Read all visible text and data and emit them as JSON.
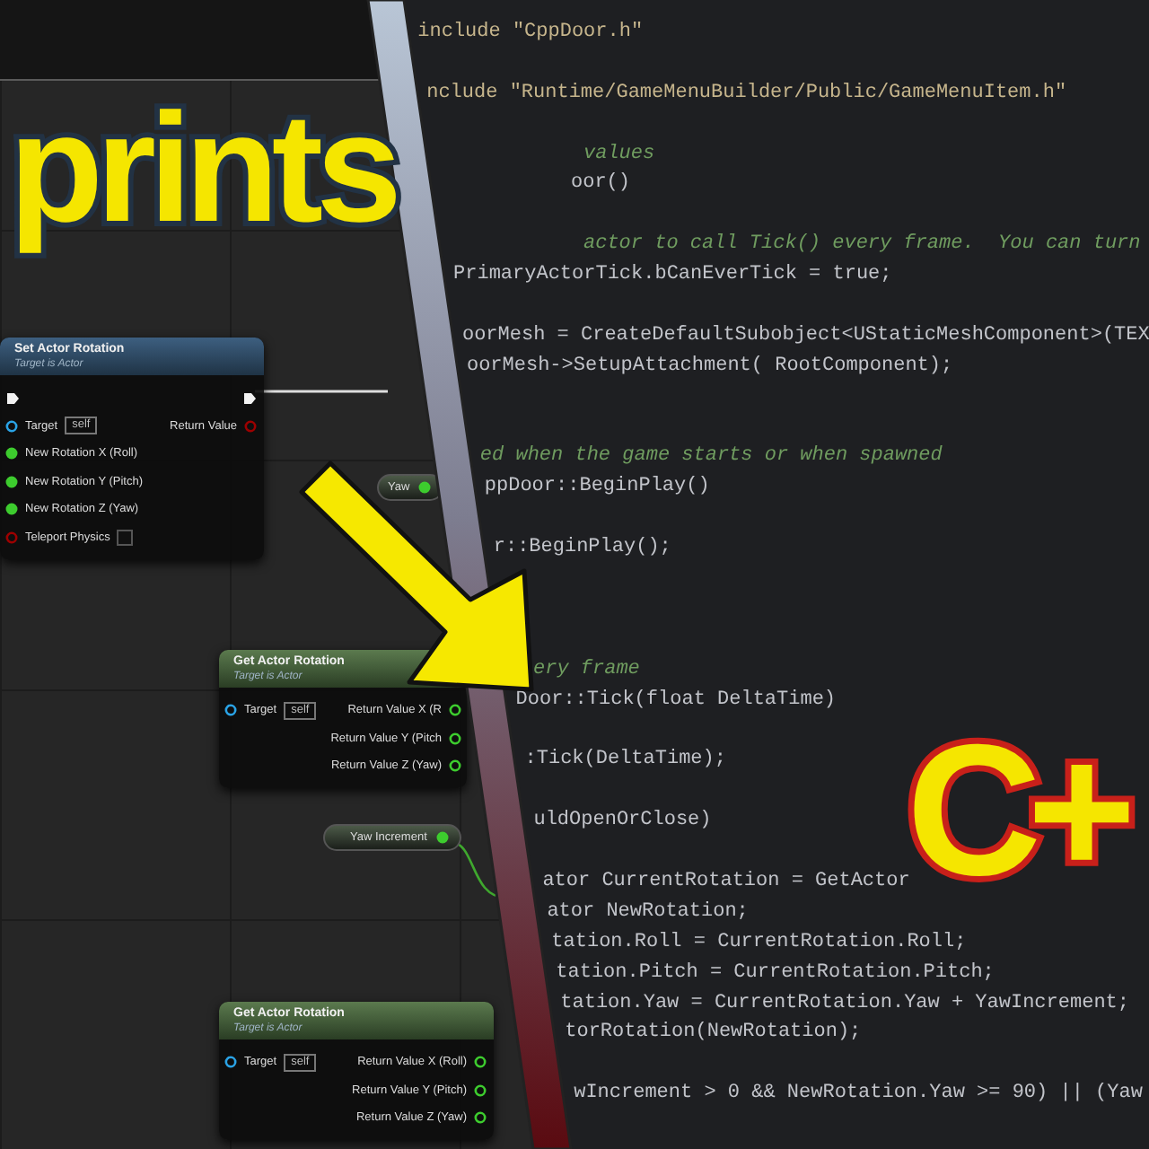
{
  "blueprint": {
    "nodes": [
      {
        "kind": "impure",
        "title": "Set Actor Rotation",
        "subtitle": "Target is Actor",
        "inputs": [
          {
            "kind": "object",
            "label": "Target",
            "value": "self"
          },
          {
            "kind": "float",
            "label": "New Rotation X (Roll)"
          },
          {
            "kind": "float",
            "label": "New Rotation Y (Pitch)"
          },
          {
            "kind": "float",
            "label": "New Rotation Z (Yaw)"
          },
          {
            "kind": "bool",
            "label": "Teleport Physics",
            "checked": false
          }
        ],
        "outputs": [
          {
            "kind": "bool",
            "label": "Return Value"
          }
        ]
      },
      {
        "kind": "variable",
        "title": "Yaw"
      },
      {
        "kind": "pure",
        "title": "Get Actor Rotation",
        "subtitle": "Target is Actor",
        "inputs": [
          {
            "kind": "object",
            "label": "Target",
            "value": "self"
          }
        ],
        "outputs": [
          {
            "kind": "float",
            "label": "Return Value X (R"
          },
          {
            "kind": "float",
            "label": "Return Value Y (Pitch"
          },
          {
            "kind": "float",
            "label": "Return Value Z (Yaw)"
          }
        ]
      },
      {
        "kind": "variable",
        "title": "Yaw Increment"
      },
      {
        "kind": "pure",
        "title": "Get Actor Rotation",
        "subtitle": "Target is Actor",
        "inputs": [
          {
            "kind": "object",
            "label": "Target",
            "value": "self"
          }
        ],
        "outputs": [
          {
            "kind": "float",
            "label": "Return Value X (Roll)"
          },
          {
            "kind": "float",
            "label": "Return Value Y (Pitch)"
          },
          {
            "kind": "float",
            "label": "Return Value Z (Yaw)"
          }
        ]
      }
    ]
  },
  "editor": {
    "lines": [
      {
        "kind": "preprocessor",
        "text": "include \"CppDoor.h\""
      },
      {
        "kind": "preprocessor",
        "text": "nclude \"Runtime/GameMenuBuilder/Public/GameMenuItem.h\""
      },
      {
        "kind": "comment",
        "text": "values"
      },
      {
        "kind": "code",
        "text": "oor()"
      },
      {
        "kind": "comment",
        "text": "actor to call Tick() every frame.  You can turn"
      },
      {
        "kind": "code",
        "text": "PrimaryActorTick.bCanEverTick = true;"
      },
      {
        "kind": "code",
        "text": "oorMesh = CreateDefaultSubobject<UStaticMeshComponent>(TEX"
      },
      {
        "kind": "code",
        "text": "oorMesh->SetupAttachment( RootComponent);"
      },
      {
        "kind": "comment",
        "text": "ed when the game starts or when spawned"
      },
      {
        "kind": "code",
        "text": "ppDoor::BeginPlay()"
      },
      {
        "kind": "code",
        "text": "r::BeginPlay();"
      },
      {
        "kind": "comment",
        "text": "ery frame"
      },
      {
        "kind": "code",
        "text": "Door::Tick(float DeltaTime)"
      },
      {
        "kind": "code",
        "text": ":Tick(DeltaTime);"
      },
      {
        "kind": "code",
        "text": "uldOpenOrClose)"
      },
      {
        "kind": "code",
        "text": "ator CurrentRotation = GetActor"
      },
      {
        "kind": "code",
        "text": "ator NewRotation;"
      },
      {
        "kind": "code",
        "text": "tation.Roll = CurrentRotation.Roll;"
      },
      {
        "kind": "code",
        "text": "tation.Pitch = CurrentRotation.Pitch;"
      },
      {
        "kind": "code",
        "text": "tation.Yaw = CurrentRotation.Yaw + YawIncrement;"
      },
      {
        "kind": "code",
        "text": "torRotation(NewRotation);"
      },
      {
        "kind": "code",
        "text": "wIncrement > 0 && NewRotation.Yaw >= 90) || (Yaw"
      }
    ]
  },
  "overlays": [
    {
      "kind": "blueprint",
      "text": "prints"
    },
    {
      "kind": "cpp",
      "text": "C+"
    }
  ]
}
